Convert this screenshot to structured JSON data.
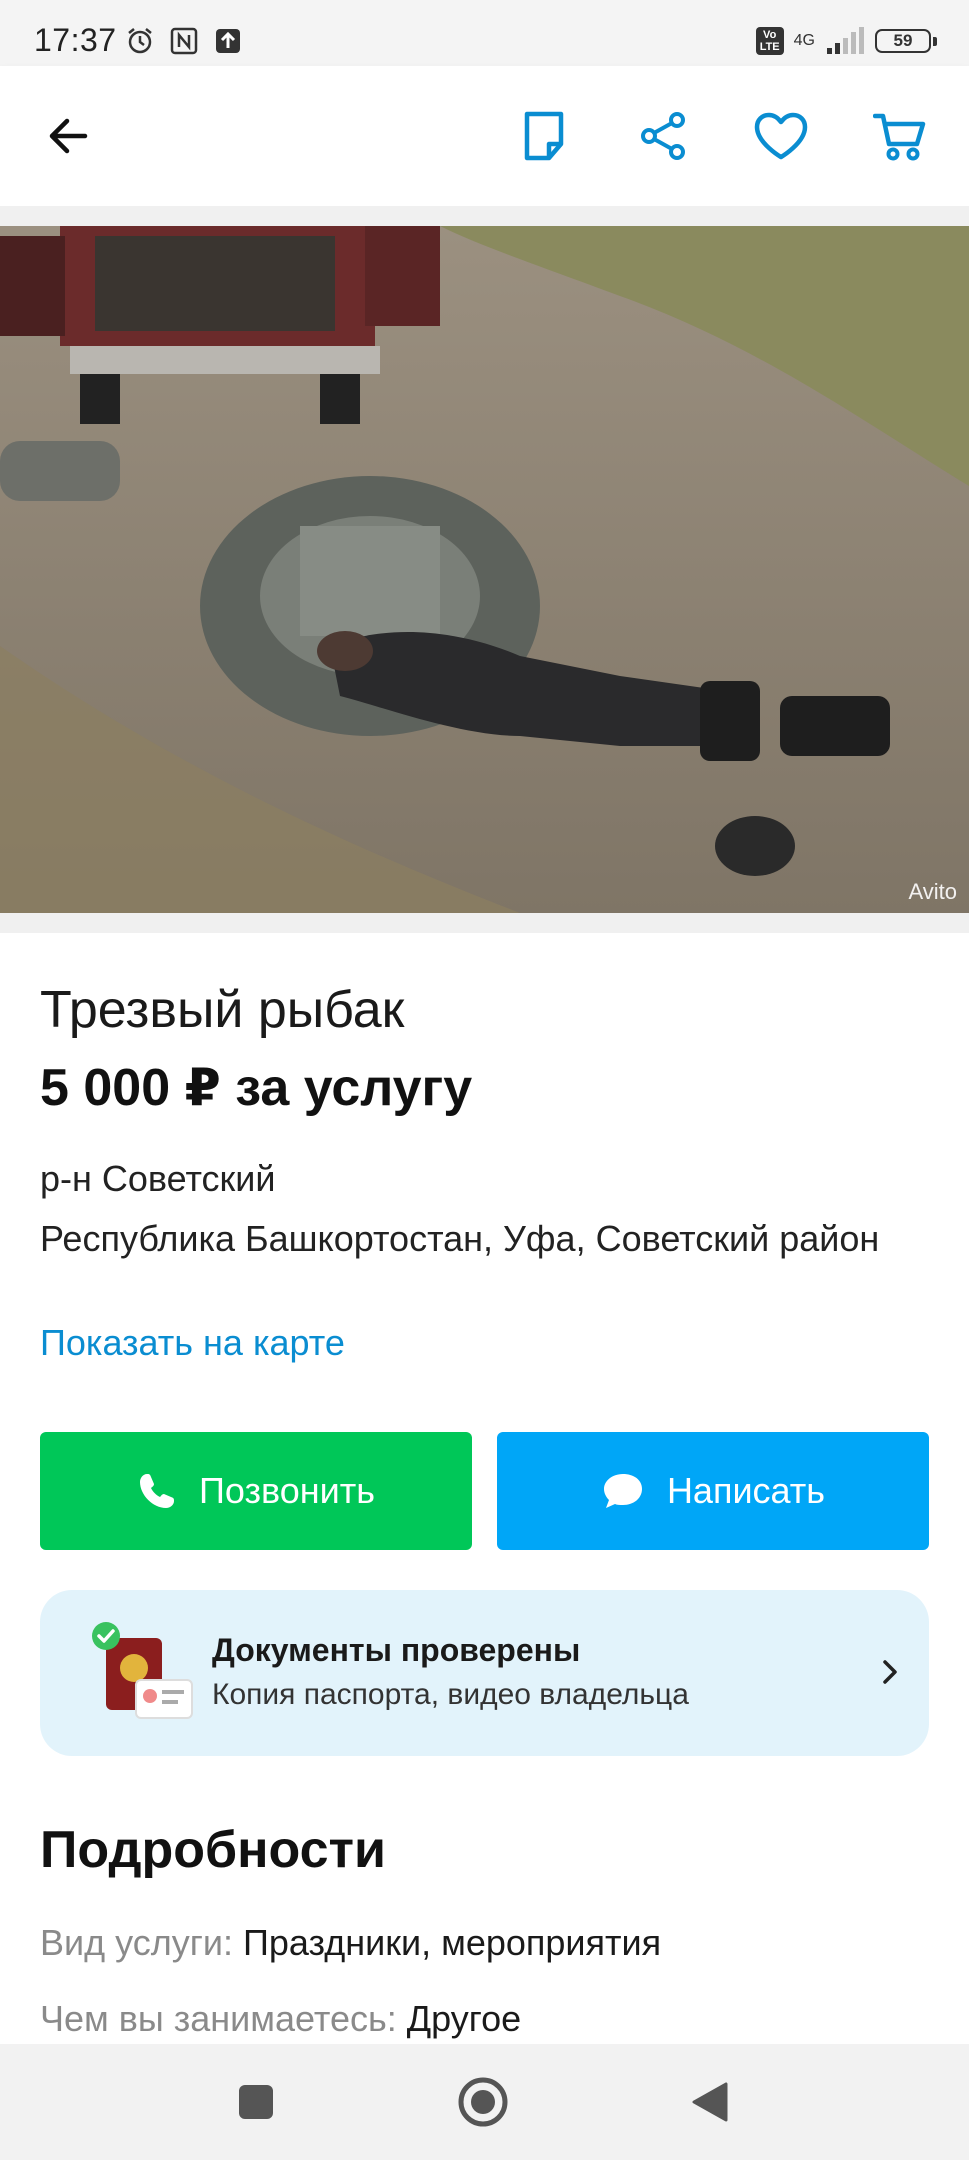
{
  "status_bar": {
    "time": "17:37",
    "network": "4G",
    "volte": "Vo LTE",
    "battery": "59"
  },
  "app_bar": {
    "icons": [
      "back-arrow-icon",
      "note-icon",
      "share-icon",
      "heart-icon",
      "cart-icon"
    ],
    "accent": "#0a8dd1"
  },
  "listing": {
    "photo_watermark": "Avito",
    "title": "Трезвый рыбак",
    "price": "5 000 ₽ за услугу",
    "district": "р-н Советский",
    "address": "Республика Башкортостан, Уфа, Советский район",
    "map_link": "Показать на карте"
  },
  "actions": {
    "call_label": "Позвонить",
    "write_label": "Написать",
    "call_color": "#00c758",
    "write_color": "#00a6f7"
  },
  "verification": {
    "title": "Документы проверены",
    "subtitle": "Копия паспорта, видео владельца"
  },
  "details": {
    "heading": "Подробности",
    "rows": [
      {
        "label": "Вид услуги:",
        "value": "Праздники, мероприятия"
      },
      {
        "label": "Чем вы занимаетесь:",
        "value": "Другое"
      }
    ]
  },
  "nav_bar": {
    "icons": [
      "recent-apps-icon",
      "home-icon",
      "back-icon"
    ]
  }
}
